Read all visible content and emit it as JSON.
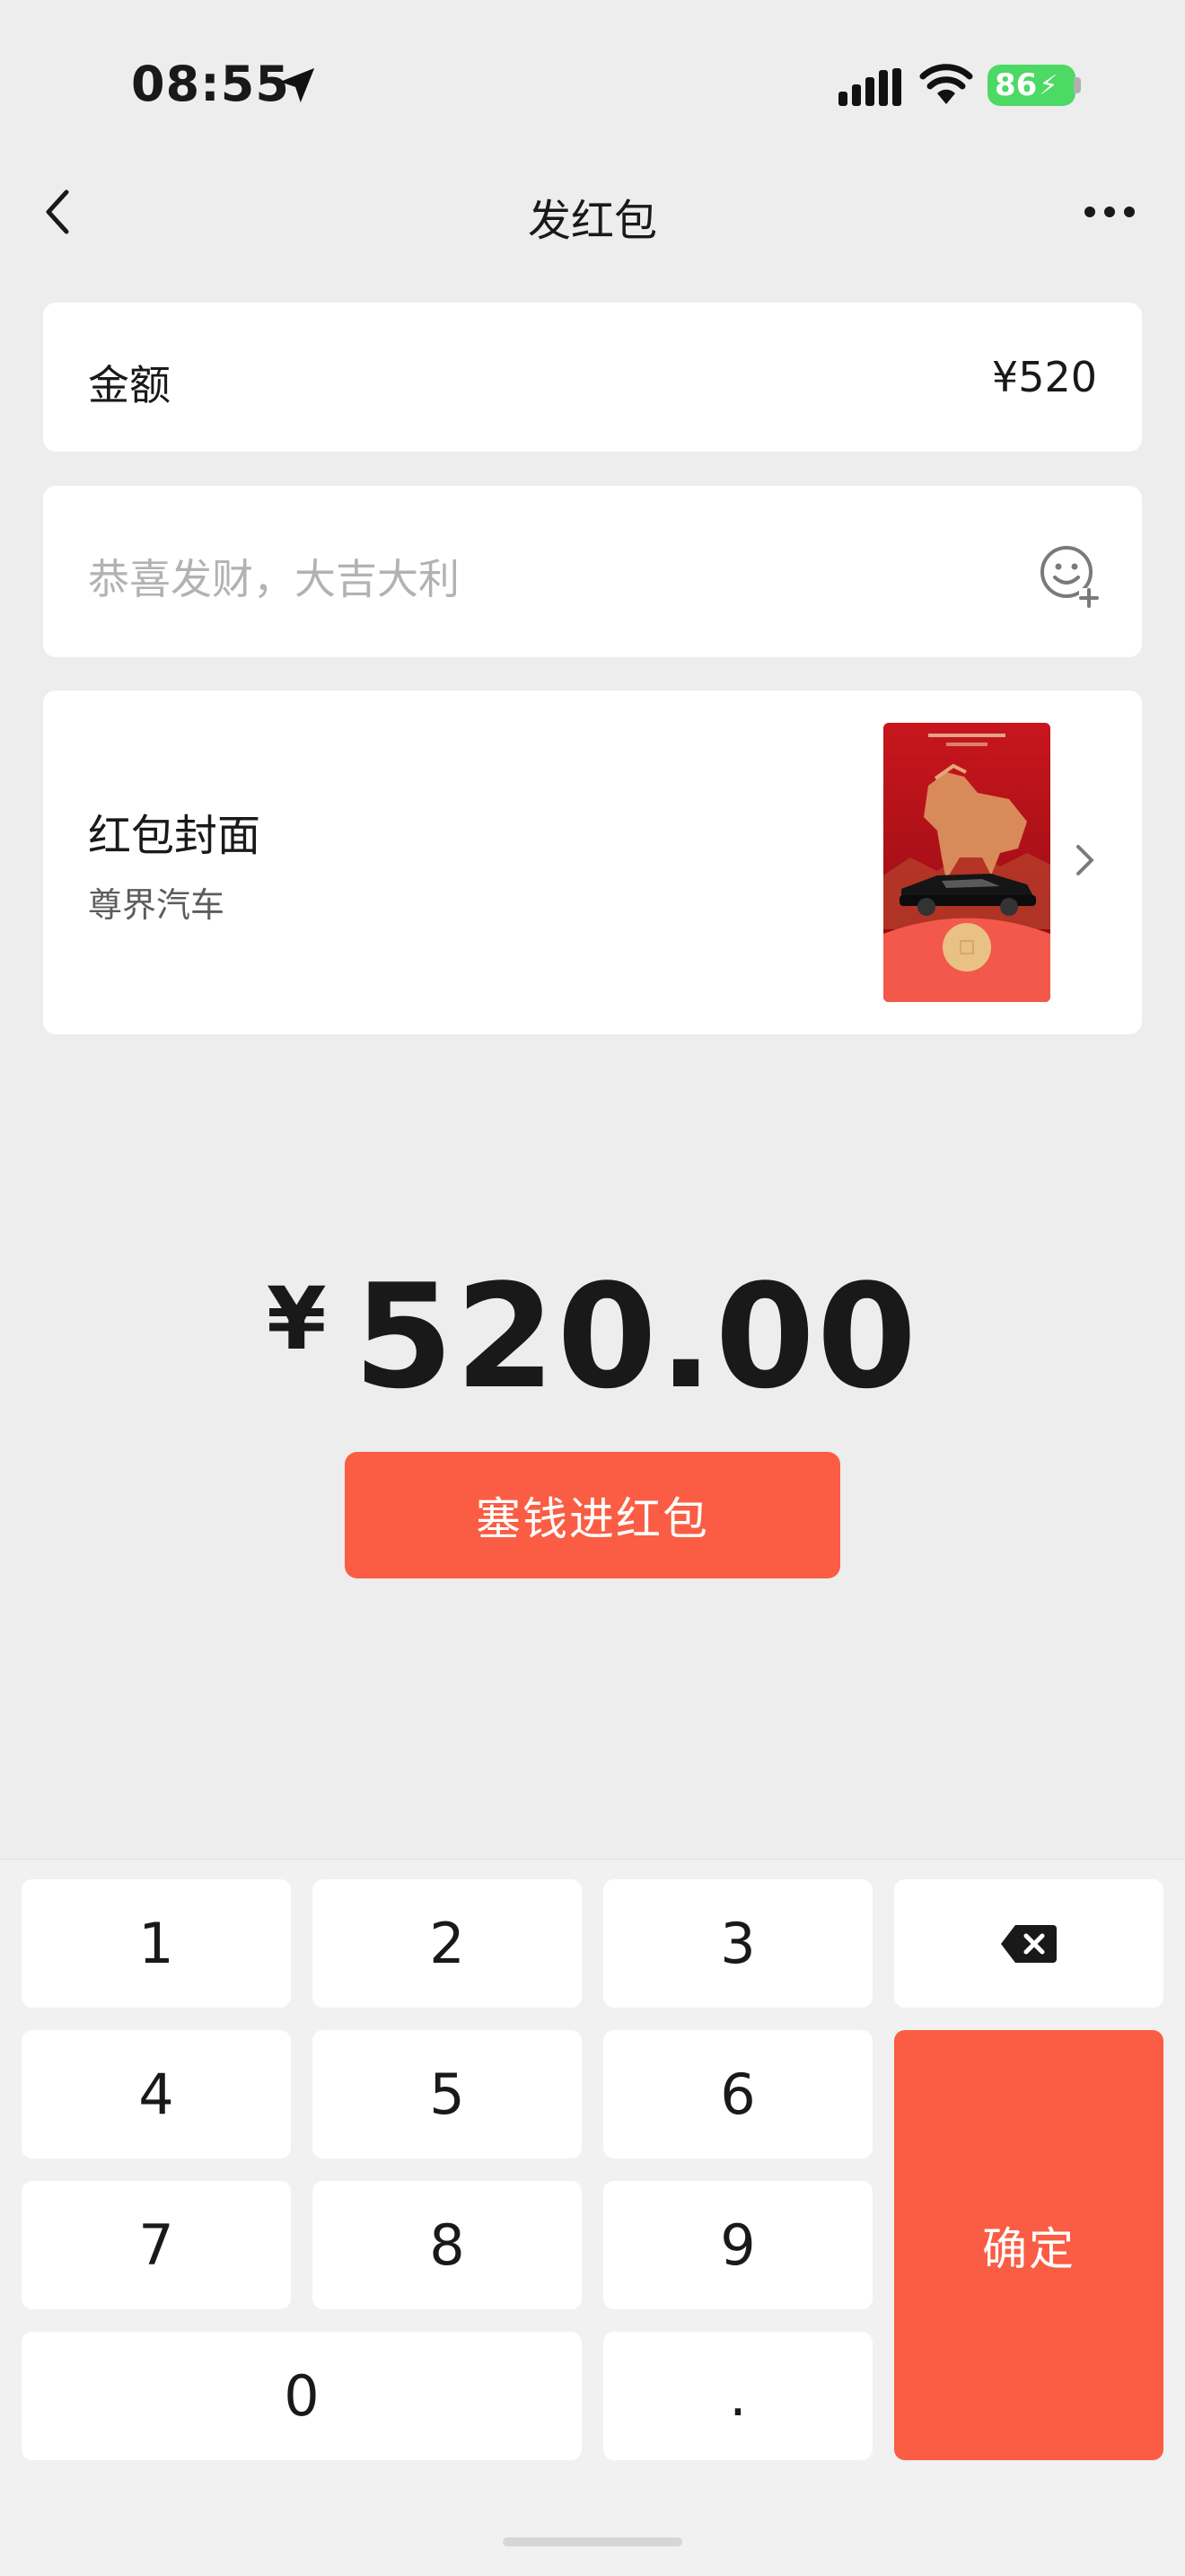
{
  "status_bar": {
    "time": "08:55",
    "battery": "86"
  },
  "nav": {
    "title": "发红包"
  },
  "amount_row": {
    "label": "金额",
    "value": "¥520"
  },
  "message": {
    "placeholder": "恭喜发财，大吉大利"
  },
  "cover": {
    "title": "红包封面",
    "subtitle": "尊界汽车"
  },
  "summary": {
    "currency": "¥",
    "amount": "520.00"
  },
  "submit_button": "塞钱进红包",
  "keypad": {
    "keys": [
      "1",
      "2",
      "3",
      "4",
      "5",
      "6",
      "7",
      "8",
      "9",
      "0",
      "."
    ],
    "confirm": "确定"
  },
  "colors": {
    "accent": "#fa5d44",
    "background": "#ededed"
  }
}
